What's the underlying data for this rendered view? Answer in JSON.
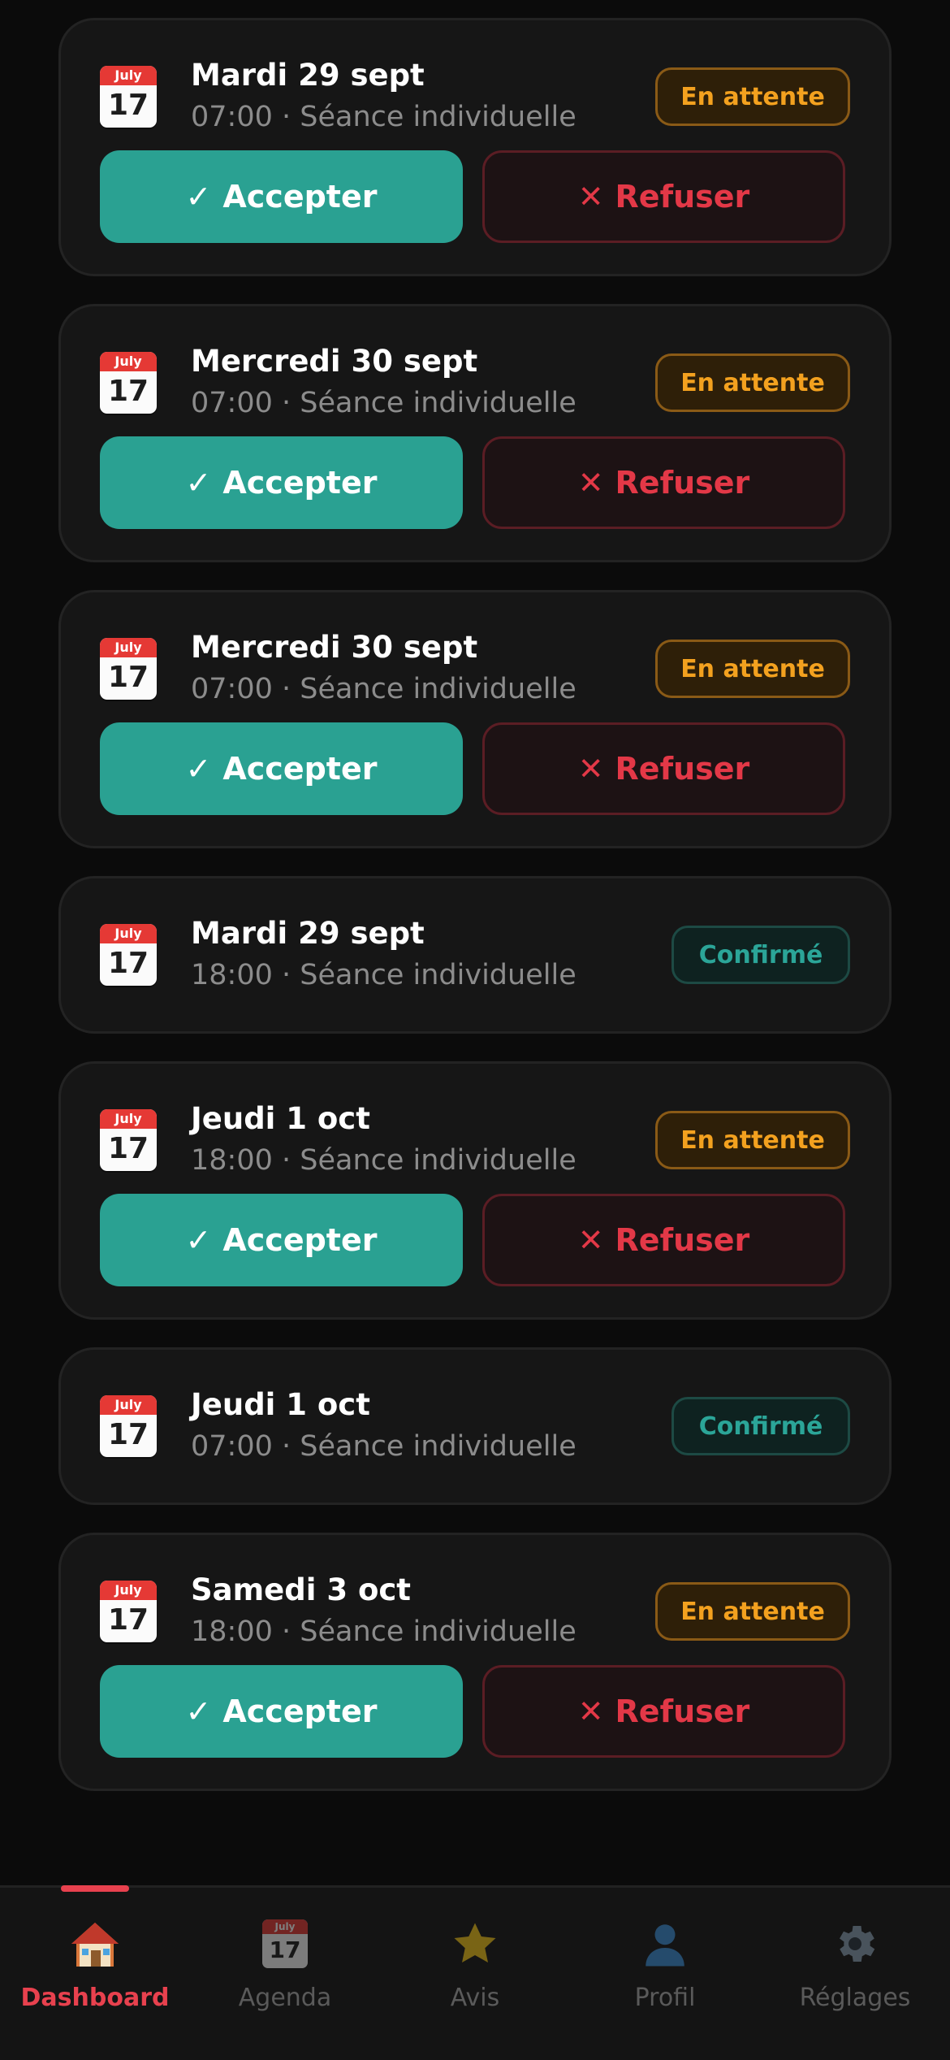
{
  "calendar_icon": {
    "month": "July",
    "day": "17"
  },
  "bookings": [
    {
      "date": "Mardi 29 sept",
      "detail": "07:00 · Séance individuelle",
      "status": "En attente",
      "accept": "Accepter",
      "refuse": "Refuser"
    },
    {
      "date": "Mercredi 30 sept",
      "detail": "07:00 · Séance individuelle",
      "status": "En attente",
      "accept": "Accepter",
      "refuse": "Refuser"
    },
    {
      "date": "Mercredi 30 sept",
      "detail": "07:00 · Séance individuelle",
      "status": "En attente",
      "accept": "Accepter",
      "refuse": "Refuser"
    },
    {
      "date": "Mardi 29 sept",
      "detail": "18:00 · Séance individuelle",
      "status": "Confirmé"
    },
    {
      "date": "Jeudi 1 oct",
      "detail": "18:00 · Séance individuelle",
      "status": "En attente",
      "accept": "Accepter",
      "refuse": "Refuser"
    },
    {
      "date": "Jeudi 1 oct",
      "detail": "07:00 · Séance individuelle",
      "status": "Confirmé"
    },
    {
      "date": "Samedi 3 oct",
      "detail": "18:00 · Séance individuelle",
      "status": "En attente",
      "accept": "Accepter",
      "refuse": "Refuser"
    }
  ],
  "action_symbols": {
    "accept": "✓",
    "refuse": "✕"
  },
  "tabs": [
    {
      "label": "Dashboard",
      "icon": "house-icon",
      "active": true
    },
    {
      "label": "Agenda",
      "icon": "calendar-icon",
      "active": false
    },
    {
      "label": "Avis",
      "icon": "star-icon",
      "active": false
    },
    {
      "label": "Profil",
      "icon": "person-icon",
      "active": false
    },
    {
      "label": "Réglages",
      "icon": "gear-icon",
      "active": false
    }
  ],
  "colors": {
    "background": "#0b0b0b",
    "card": "#161616",
    "accent_teal": "#2aa192",
    "refuse_red": "#e33847",
    "pending_orange": "#f3a11f",
    "confirmed_teal": "#2ba598",
    "active_tab": "#e8414e"
  }
}
